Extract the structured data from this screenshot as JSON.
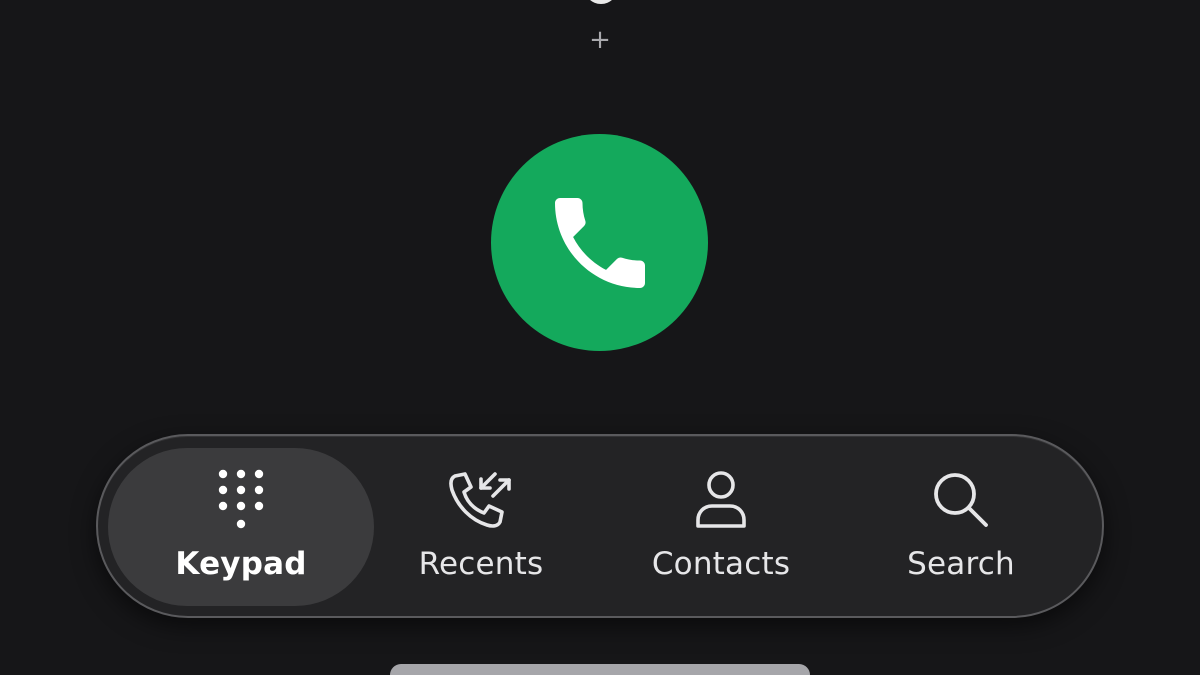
{
  "dialer": {
    "plus_label": "+"
  },
  "call_button": {
    "icon": "phone-icon",
    "color": "#14a95c"
  },
  "bottom_nav": {
    "active": "Keypad",
    "items": [
      {
        "label": "Keypad",
        "icon": "dialpad-icon"
      },
      {
        "label": "Recents",
        "icon": "recent-calls-icon"
      },
      {
        "label": "Contacts",
        "icon": "person-icon"
      },
      {
        "label": "Search",
        "icon": "search-icon"
      }
    ]
  }
}
